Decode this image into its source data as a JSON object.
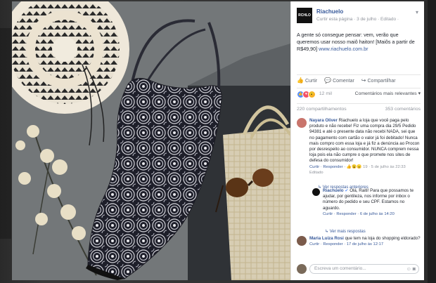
{
  "page": {
    "name": "Riachuelo",
    "logo_text": "RCHLO",
    "meta": "Curtir esta página · 3 de julho · Editado ·",
    "post_text": "A gente só consegue pensar: vem, verão que queremos usar nosso maiô haiton! [Maiôs a partir de R$49,90]",
    "post_link": "www.riachuelo.com.br"
  },
  "actions": {
    "like": "Curtir",
    "comment": "Comentar",
    "share": "Compartilhar"
  },
  "reactions": {
    "count": "12 mil",
    "sort": "Comentários mais relevantes ▾"
  },
  "shares": {
    "shares": "220 compartilhamentos",
    "comments": "353 comentários"
  },
  "comments": [
    {
      "name": "Nayara Oliver",
      "text": "Riachuelo a loja que você paga pelo produto e não recebe! Fiz uma compra dia 29/5 Pedido 94381 e até o presente data não recebi NADA, sei que no pagamento com cartão o valor já foi debitado! Nunca mais compro com essa loja e já fiz a denúncia ao Procon por desrespeito ao consumidor. NUNCA comprem nessa loja pois ela não cumpre o que promete nos sites de defesa do consumidor!",
      "actions": "Curtir · Responder · ",
      "reactions_count": "19",
      "time": "· 5 de julho às 22:33",
      "edited": "Editado"
    },
    {
      "replies_link": "Ver respostas anteriores"
    },
    {
      "name": "Riachuelo",
      "text": "Olá, Raiti! Para que possamos te ajudar, por gentileza, nos informe por inbox o número do pedido e seu CPF. Estamos no aguardo.",
      "actions": "Curtir · Responder · 6 de julho às 14:20"
    },
    {
      "more_replies": "Ver mais respostas"
    },
    {
      "name": "Maria Luiza Rosi",
      "text": "que tem na loja do shopping eldorado?",
      "actions": "Curtir · Responder · 17 de julho às 12:17"
    }
  ],
  "comment_box": {
    "placeholder": "Escreva um comentário..."
  },
  "colors": {
    "link": "#365899",
    "muted": "#90949c",
    "like": "#5890ff",
    "love": "#f25268",
    "wow": "#f7b125"
  }
}
